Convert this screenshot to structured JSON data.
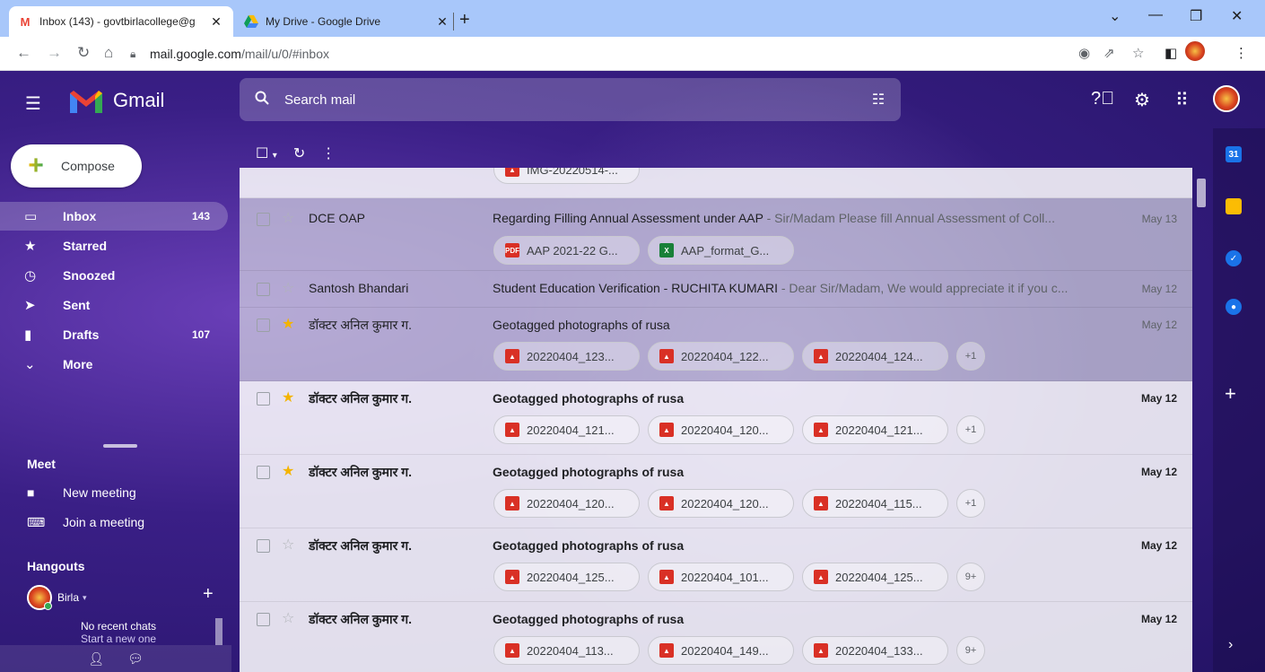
{
  "browser": {
    "tabs": [
      {
        "title": "Inbox (143) - govtbirlacollege@g",
        "icon": "gmail-favicon"
      },
      {
        "title": "My Drive - Google Drive",
        "icon": "drive-favicon"
      }
    ],
    "url_host": "mail.google.com",
    "url_path": "/mail/u/0/#inbox"
  },
  "gmail": {
    "logo_text": "Gmail",
    "search_placeholder": "Search mail",
    "compose_label": "Compose",
    "nav": [
      {
        "label": "Inbox",
        "count": "143",
        "icon": "inbox-icon"
      },
      {
        "label": "Starred",
        "count": "",
        "icon": "star-icon"
      },
      {
        "label": "Snoozed",
        "count": "",
        "icon": "clock-icon"
      },
      {
        "label": "Sent",
        "count": "",
        "icon": "send-icon"
      },
      {
        "label": "Drafts",
        "count": "107",
        "icon": "file-icon"
      },
      {
        "label": "More",
        "count": "",
        "icon": "chevron-down-icon"
      }
    ],
    "meet": {
      "title": "Meet",
      "new_meeting": "New meeting",
      "join_meeting": "Join a meeting"
    },
    "hangouts": {
      "title": "Hangouts",
      "user": "Birla",
      "no_chats": "No recent chats",
      "start_new": "Start a new one"
    }
  },
  "emails": [
    {
      "sender": "",
      "subject": "",
      "snippet": "",
      "date": "",
      "starred": false,
      "unread": false,
      "attachments": [
        {
          "type": "img",
          "name": "IMG-20220514-..."
        }
      ],
      "more": ""
    },
    {
      "sender": "DCE OAP",
      "subject": "Regarding Filling Annual Assessment under AAP",
      "snippet": " - Sir/Madam Please fill Annual Assessment of Coll...",
      "date": "May 13",
      "starred": false,
      "unread": false,
      "attachments": [
        {
          "type": "pdf",
          "name": "AAP 2021-22 G..."
        },
        {
          "type": "xls",
          "name": "AAP_format_G..."
        }
      ],
      "more": ""
    },
    {
      "sender": "Santosh Bhandari",
      "subject": "Student Education Verification - RUCHITA KUMARI",
      "snippet": " - Dear Sir/Madam, We would appreciate it if you c...",
      "date": "May 12",
      "starred": false,
      "unread": false,
      "attachments": [],
      "more": ""
    },
    {
      "sender": "डॉक्टर अनिल कुमार ग.",
      "subject": "Geotagged photographs of rusa",
      "snippet": "",
      "date": "May 12",
      "starred": true,
      "unread": false,
      "attachments": [
        {
          "type": "img",
          "name": "20220404_123..."
        },
        {
          "type": "img",
          "name": "20220404_122..."
        },
        {
          "type": "img",
          "name": "20220404_124..."
        }
      ],
      "more": "+1"
    },
    {
      "sender": "डॉक्टर अनिल कुमार ग.",
      "subject": "Geotagged photographs of rusa",
      "snippet": "",
      "date": "May 12",
      "starred": true,
      "unread": true,
      "attachments": [
        {
          "type": "img",
          "name": "20220404_121..."
        },
        {
          "type": "img",
          "name": "20220404_120..."
        },
        {
          "type": "img",
          "name": "20220404_121..."
        }
      ],
      "more": "+1"
    },
    {
      "sender": "डॉक्टर अनिल कुमार ग.",
      "subject": "Geotagged photographs of rusa",
      "snippet": "",
      "date": "May 12",
      "starred": true,
      "unread": true,
      "attachments": [
        {
          "type": "img",
          "name": "20220404_120..."
        },
        {
          "type": "img",
          "name": "20220404_120..."
        },
        {
          "type": "img",
          "name": "20220404_115..."
        }
      ],
      "more": "+1"
    },
    {
      "sender": "डॉक्टर अनिल कुमार ग.",
      "subject": "Geotagged photographs of rusa",
      "snippet": "",
      "date": "May 12",
      "starred": false,
      "unread": true,
      "attachments": [
        {
          "type": "img",
          "name": "20220404_125..."
        },
        {
          "type": "img",
          "name": "20220404_101..."
        },
        {
          "type": "img",
          "name": "20220404_125..."
        }
      ],
      "more": "9+"
    },
    {
      "sender": "डॉक्टर अनिल कुमार ग.",
      "subject": "Geotagged photographs of rusa",
      "snippet": "",
      "date": "May 12",
      "starred": false,
      "unread": true,
      "attachments": [
        {
          "type": "img",
          "name": "20220404_113..."
        },
        {
          "type": "img",
          "name": "20220404_149..."
        },
        {
          "type": "img",
          "name": "20220404_133..."
        }
      ],
      "more": "9+"
    }
  ],
  "side_panel": [
    {
      "icon": "calendar-icon",
      "color": "#1a73e8",
      "label": "31"
    },
    {
      "icon": "keep-icon",
      "color": "#fbbc04",
      "label": ""
    },
    {
      "icon": "tasks-icon",
      "color": "#1a73e8",
      "label": ""
    },
    {
      "icon": "contacts-icon",
      "color": "#1a73e8",
      "label": ""
    }
  ]
}
